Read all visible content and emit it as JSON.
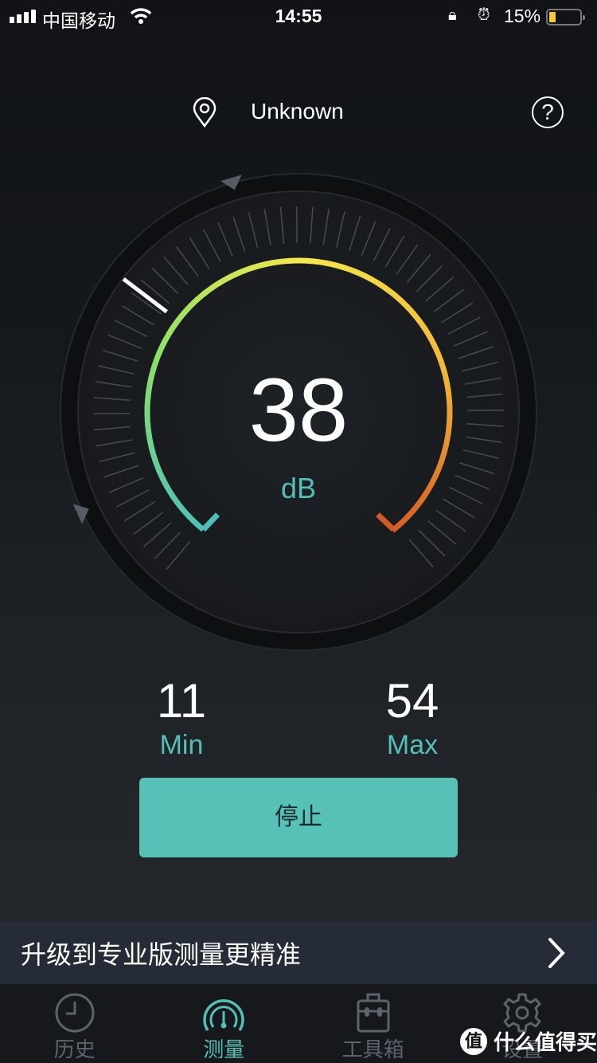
{
  "status_bar": {
    "carrier": "中国移动",
    "time": "14:55",
    "battery_percent_label": "15%",
    "battery_level": 0.15,
    "icons": [
      "signal-icon",
      "wifi-icon",
      "rotation-lock-icon",
      "alarm-icon",
      "battery-icon"
    ]
  },
  "header": {
    "location": "Unknown",
    "location_icon": "location-pin-icon",
    "help_icon": "help-icon",
    "help_glyph": "?"
  },
  "gauge": {
    "value": 38,
    "unit": "dB",
    "min_marker": 11,
    "max_marker": 54,
    "colors": [
      "#4fc0b8",
      "#8de06a",
      "#f5e84a",
      "#f2b93a",
      "#d45a26"
    ]
  },
  "stats": {
    "min_value": "11",
    "min_label": "Min",
    "max_value": "54",
    "max_label": "Max"
  },
  "stop_button": "停止",
  "accent": "#57c1b8",
  "upgrade_banner": {
    "text": "升级到专业版测量更精准",
    "chevron": "›"
  },
  "tabs": [
    {
      "label": "历史",
      "icon": "clock-icon",
      "active": false
    },
    {
      "label": "测量",
      "icon": "gauge-icon",
      "active": true
    },
    {
      "label": "工具箱",
      "icon": "toolbox-icon",
      "active": false
    },
    {
      "label": "设置",
      "icon": "gear-icon",
      "active": false
    }
  ],
  "watermark": {
    "logo": "值",
    "text": "什么值得买"
  }
}
